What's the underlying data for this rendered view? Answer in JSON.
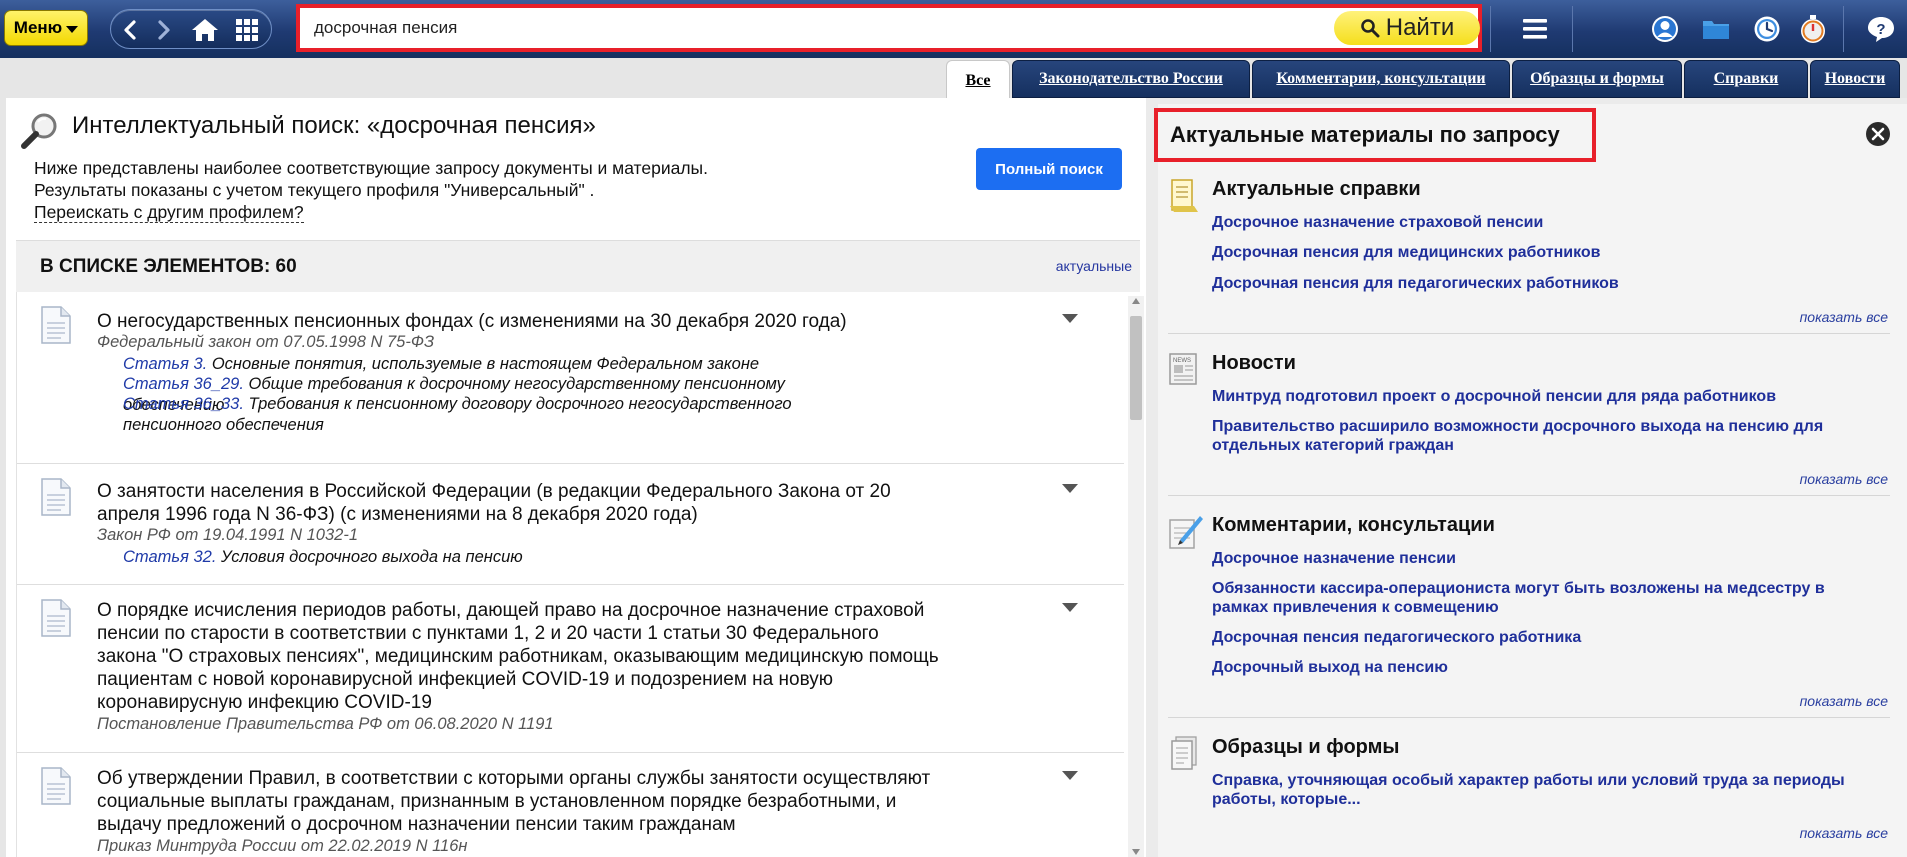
{
  "topbar": {
    "menu_label": "Меню",
    "search_value": "досрочная пенсия",
    "search_button": "Найти"
  },
  "tabs": [
    {
      "label": "Все",
      "active": true
    },
    {
      "label": "Законодательство России"
    },
    {
      "label": "Комментарии, консультации"
    },
    {
      "label": "Образцы и формы"
    },
    {
      "label": "Справки"
    },
    {
      "label": "Новости"
    }
  ],
  "left": {
    "title": "Интеллектуальный поиск: «досрочная пенсия»",
    "desc_line1": "Ниже представлены наиболее соответствующие запросу документы и материалы.",
    "desc_line2": "Результаты показаны с учетом текущего профиля \"Универсальный\" .",
    "reprofile_link": "Переискать с другим профилем?",
    "full_search_button": "Полный поиск",
    "count_label": "В СПИСКЕ ЭЛЕМЕНТОВ: 60",
    "sort_link": "актуальные",
    "results": [
      {
        "title_lines": [
          "О негосударственных пенсионных фондах (с изменениями на 30 декабря 2020 года)"
        ],
        "subtitle": "Федеральный закон от 07.05.1998 N 75-ФЗ",
        "sections": [
          {
            "ref": "Статья 3.",
            "text": " Основные понятия, используемые в настоящем Федеральном законе"
          },
          {
            "ref": "Статья 36_29.",
            "text": " Общие требования к досрочному негосударственному пенсионному обеспечению"
          },
          {
            "ref": "Статья 36_33.",
            "text": " Требования к пенсионному договору досрочного негосударственного пенсионного обеспечения"
          }
        ]
      },
      {
        "title_lines": [
          "О занятости населения в Российской Федерации (в редакции Федерального Закона от 20",
          "апреля 1996 года N 36-ФЗ) (с изменениями на 8 декабря 2020 года)"
        ],
        "subtitle": "Закон РФ от 19.04.1991 N 1032-1",
        "sections": [
          {
            "ref": "Статья 32.",
            "text": " Условия досрочного выхода на пенсию"
          }
        ]
      },
      {
        "title_lines": [
          "О порядке исчисления периодов работы, дающей право на досрочное назначение страховой",
          "пенсии по старости в соответствии с пунктами 1, 2 и 20 части 1 статьи 30 Федерального",
          "закона \"О страховых пенсиях\", медицинским работникам, оказывающим медицинскую помощь",
          "пациентам с новой коронавирусной инфекцией COVID-19 и подозрением на новую",
          "коронавирусную инфекцию COVID-19"
        ],
        "subtitle": "Постановление Правительства РФ от 06.08.2020 N 1191",
        "sections": []
      },
      {
        "title_lines": [
          "Об утверждении Правил, в соответствии с которыми органы службы занятости осуществляют",
          "социальные выплаты гражданам, признанным в установленном порядке безработными, и",
          "выдачу предложений о досрочном назначении пенсии таким гражданам"
        ],
        "subtitle": "Приказ Минтруда России от 22.02.2019 N 116н",
        "sections": []
      }
    ]
  },
  "right": {
    "title": "Актуальные материалы по запросу",
    "show_all": "показать все",
    "sections": [
      {
        "title": "Актуальные справки",
        "icon": "reference-icon",
        "links": [
          [
            "Досрочное назначение страховой пенсии"
          ],
          [
            "Досрочная пенсия для медицинских работников"
          ],
          [
            "Досрочная пенсия для педагогических работников"
          ]
        ]
      },
      {
        "title": "Новости",
        "icon": "news-icon",
        "links": [
          [
            "Минтруд подготовил проект о досрочной пенсии для ряда работников"
          ],
          [
            "Правительство расширило возможности досрочного выхода на пенсию для",
            "отдельных категорий граждан"
          ]
        ]
      },
      {
        "title": "Комментарии, консультации",
        "icon": "comment-icon",
        "links": [
          [
            "Досрочное назначение пенсии"
          ],
          [
            "Обязанности кассира-операциониста могут быть возложены на медсестру в",
            "рамках привлечения к совмещению"
          ],
          [
            "Досрочная пенсия педагогического работника"
          ],
          [
            "Досрочный выход на пенсию"
          ]
        ]
      },
      {
        "title": "Образцы и формы",
        "icon": "forms-icon",
        "links": [
          [
            "Справка, уточняющая особый характер работы или условий труда за периоды",
            "работы, которые..."
          ]
        ]
      }
    ]
  }
}
